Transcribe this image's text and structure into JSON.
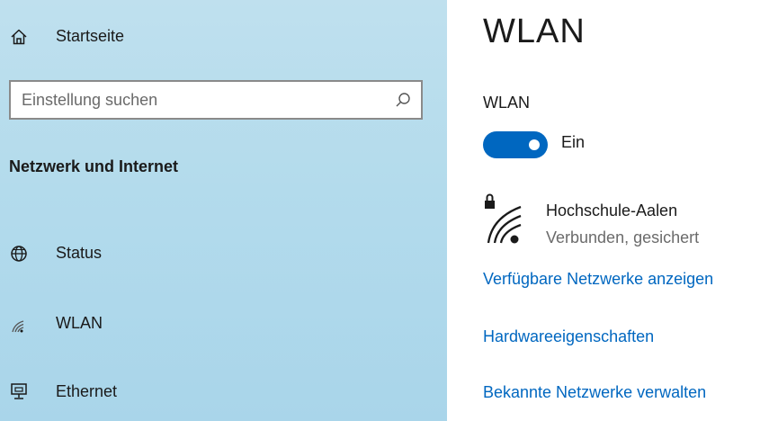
{
  "sidebar": {
    "home_label": "Startseite",
    "search": {
      "placeholder": "Einstellung suchen",
      "value": ""
    },
    "section_title": "Netzwerk und Internet",
    "items": [
      {
        "label": "Status",
        "icon": "globe-icon"
      },
      {
        "label": "WLAN",
        "icon": "wifi-icon"
      },
      {
        "label": "Ethernet",
        "icon": "ethernet-icon"
      }
    ]
  },
  "main": {
    "title": "WLAN",
    "wlan_label": "WLAN",
    "toggle": {
      "state": "on",
      "state_label": "Ein"
    },
    "network": {
      "name": "Hochschule-Aalen",
      "status": "Verbunden, gesichert",
      "icon": "secured-wifi-icon"
    },
    "links": [
      "Verfügbare Netzwerke anzeigen",
      "Hardwareeigenschaften",
      "Bekannte Netzwerke verwalten"
    ]
  },
  "colors": {
    "accent": "#0067c0",
    "sidebar_bg": "#b3dbec",
    "secondary_text": "#6b6b6b"
  }
}
